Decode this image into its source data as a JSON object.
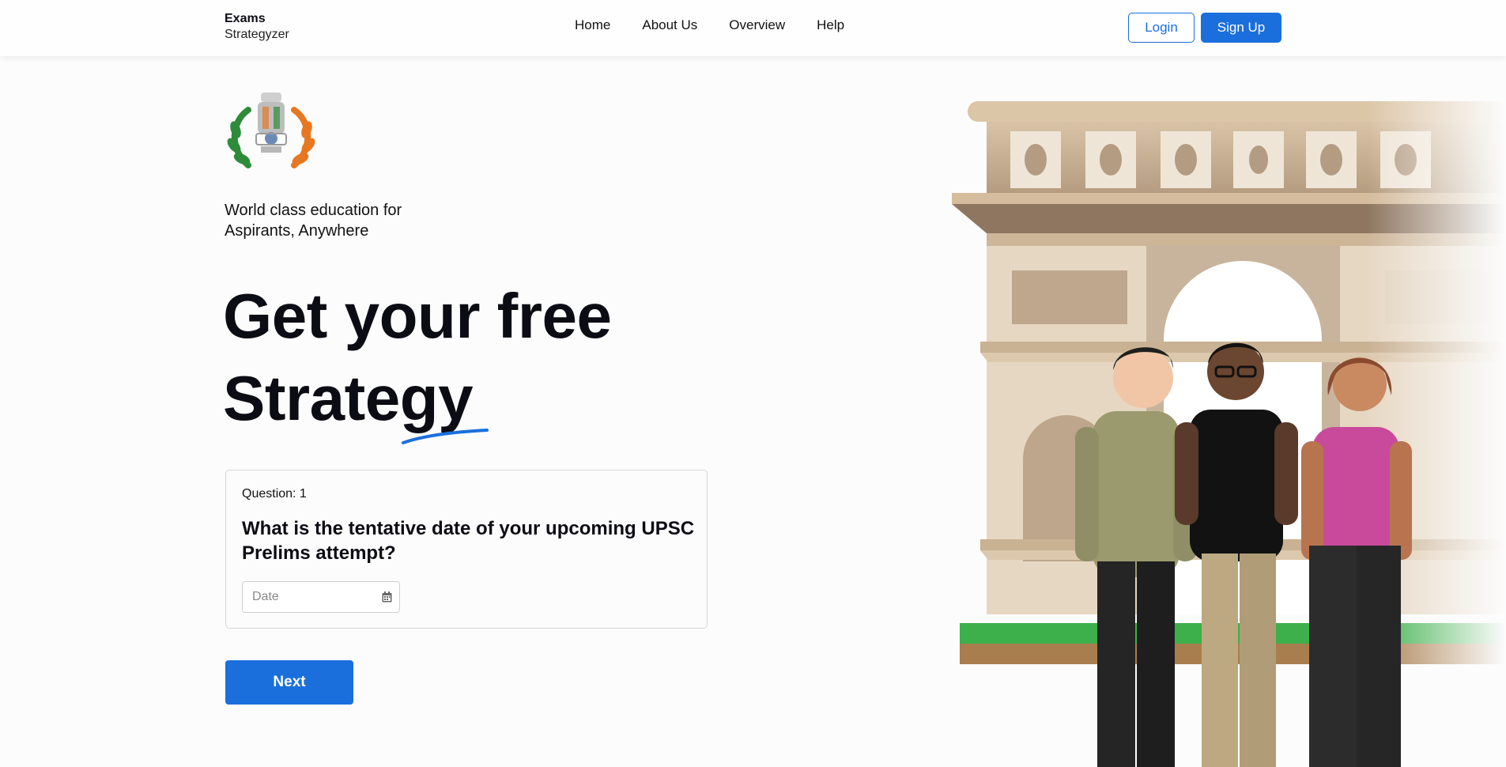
{
  "navbar": {
    "brand_top": "Exams",
    "brand_bottom": "Strategyzer",
    "links": [
      "Home",
      "About Us",
      "Overview",
      "Help"
    ],
    "login_label": "Login",
    "signup_label": "Sign Up"
  },
  "hero": {
    "emblem_icon": "national-emblem-icon",
    "tagline": "World class education for Aspirants, Anywhere",
    "headline_line1": "Get your free",
    "headline_line2": "Strategy"
  },
  "question_card": {
    "number_label": "Question: 1",
    "question_text": "What is the tentative date of your upcoming UPSC Prelims attempt?",
    "date_placeholder": "Date",
    "calendar_icon": "calendar-icon"
  },
  "actions": {
    "next_label": "Next"
  },
  "colors": {
    "accent": "#1a6fdc",
    "text": "#0c0c14",
    "background": "#fcfcfc"
  }
}
